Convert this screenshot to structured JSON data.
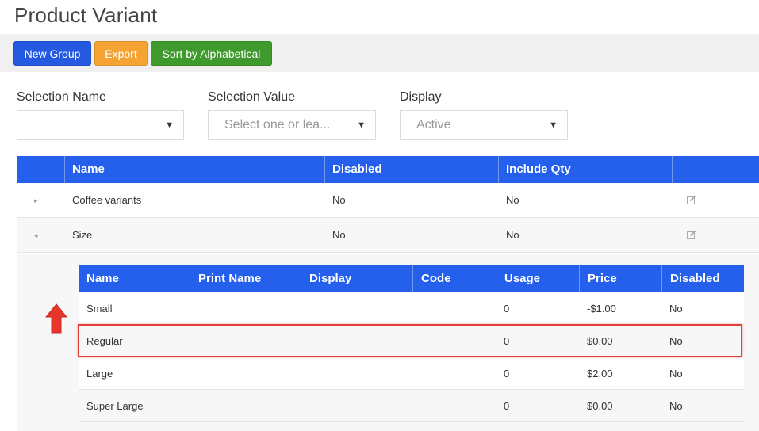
{
  "page": {
    "title": "Product Variant"
  },
  "toolbar": {
    "new_group_label": "New Group",
    "export_label": "Export",
    "sort_label": "Sort by Alphabetical"
  },
  "filters": {
    "selection_name": {
      "label": "Selection Name",
      "value": ""
    },
    "selection_value": {
      "label": "Selection Value",
      "placeholder": "Select one or lea..."
    },
    "display": {
      "label": "Display",
      "value": "Active"
    }
  },
  "groups_table": {
    "headers": [
      "Name",
      "Disabled",
      "Include Qty"
    ],
    "rows": [
      {
        "expander": "▸",
        "name": "Coffee variants",
        "disabled": "No",
        "include_qty": "No"
      },
      {
        "expander": "◂",
        "name": "Size",
        "disabled": "No",
        "include_qty": "No"
      }
    ]
  },
  "variants_table": {
    "headers": [
      "Name",
      "Print Name",
      "Display",
      "Code",
      "Usage",
      "Price",
      "Disabled"
    ],
    "rows": [
      {
        "name": "Small",
        "print_name": "",
        "display": "",
        "code": "",
        "usage": "0",
        "price": "-$1.00",
        "disabled": "No"
      },
      {
        "name": "Regular",
        "print_name": "",
        "display": "",
        "code": "",
        "usage": "0",
        "price": "$0.00",
        "disabled": "No"
      },
      {
        "name": "Large",
        "print_name": "",
        "display": "",
        "code": "",
        "usage": "0",
        "price": "$2.00",
        "disabled": "No"
      },
      {
        "name": "Super Large",
        "print_name": "",
        "display": "",
        "code": "",
        "usage": "0",
        "price": "$0.00",
        "disabled": "No"
      }
    ]
  },
  "icons": {
    "edit": "edit-icon",
    "caret": "caret-down-icon",
    "arrow": "up-arrow-icon"
  },
  "colors": {
    "primary": "#2460ec",
    "warning": "#f5a433",
    "success": "#3e9a2c",
    "highlight": "#e0403a"
  }
}
